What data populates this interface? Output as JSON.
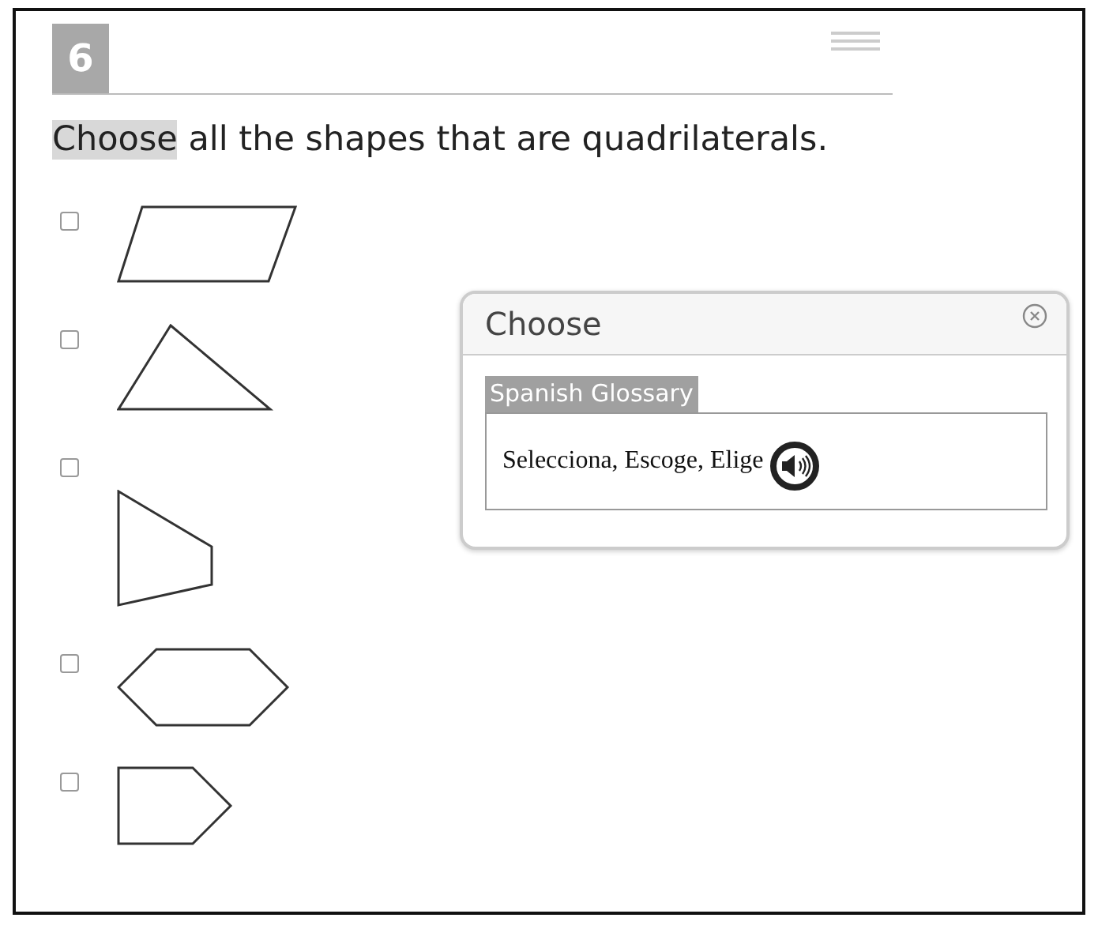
{
  "question": {
    "number": "6",
    "prompt": [
      {
        "text": "Choose",
        "highlighted": true
      },
      {
        "text": " all the shapes that are quadrilaterals.",
        "highlighted": false
      }
    ]
  },
  "options": [
    {
      "kind": "parallelogram",
      "checked": false
    },
    {
      "kind": "triangle",
      "checked": false
    },
    {
      "kind": "trapezoid",
      "checked": false
    },
    {
      "kind": "hexagon",
      "checked": false
    },
    {
      "kind": "pentagon",
      "checked": false
    }
  ],
  "popup": {
    "title": "Choose",
    "glossary_label": "Spanish Glossary",
    "definition": "Selecciona, Escoge, Elige"
  }
}
